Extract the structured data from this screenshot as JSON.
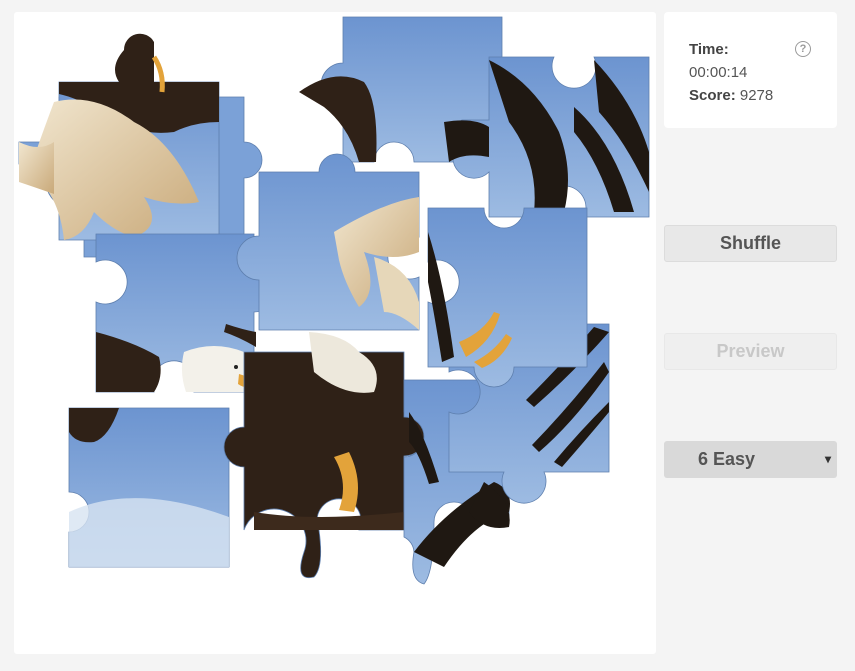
{
  "stats": {
    "time_label": "Time:",
    "time_value": "00:00:14",
    "score_label": "Score:",
    "score_value": "9278",
    "help_icon": "?"
  },
  "controls": {
    "shuffle_label": "Shuffle",
    "preview_label": "Preview",
    "difficulty_selected": "6 Easy",
    "difficulty_caret": "▾"
  },
  "colors": {
    "sky": "#7ba1d7",
    "sky_light": "#b7cde8",
    "eagle_dark": "#2f2117",
    "feather_light": "#e6d7b9",
    "talon": "#e3a33a"
  },
  "puzzle": {
    "image_subject": "bald eagle in flight",
    "pieces": [
      "piece-1",
      "piece-2",
      "piece-3",
      "piece-4",
      "piece-5",
      "piece-6",
      "piece-7",
      "piece-8",
      "piece-9",
      "piece-10",
      "piece-11",
      "piece-12",
      "piece-13"
    ]
  }
}
